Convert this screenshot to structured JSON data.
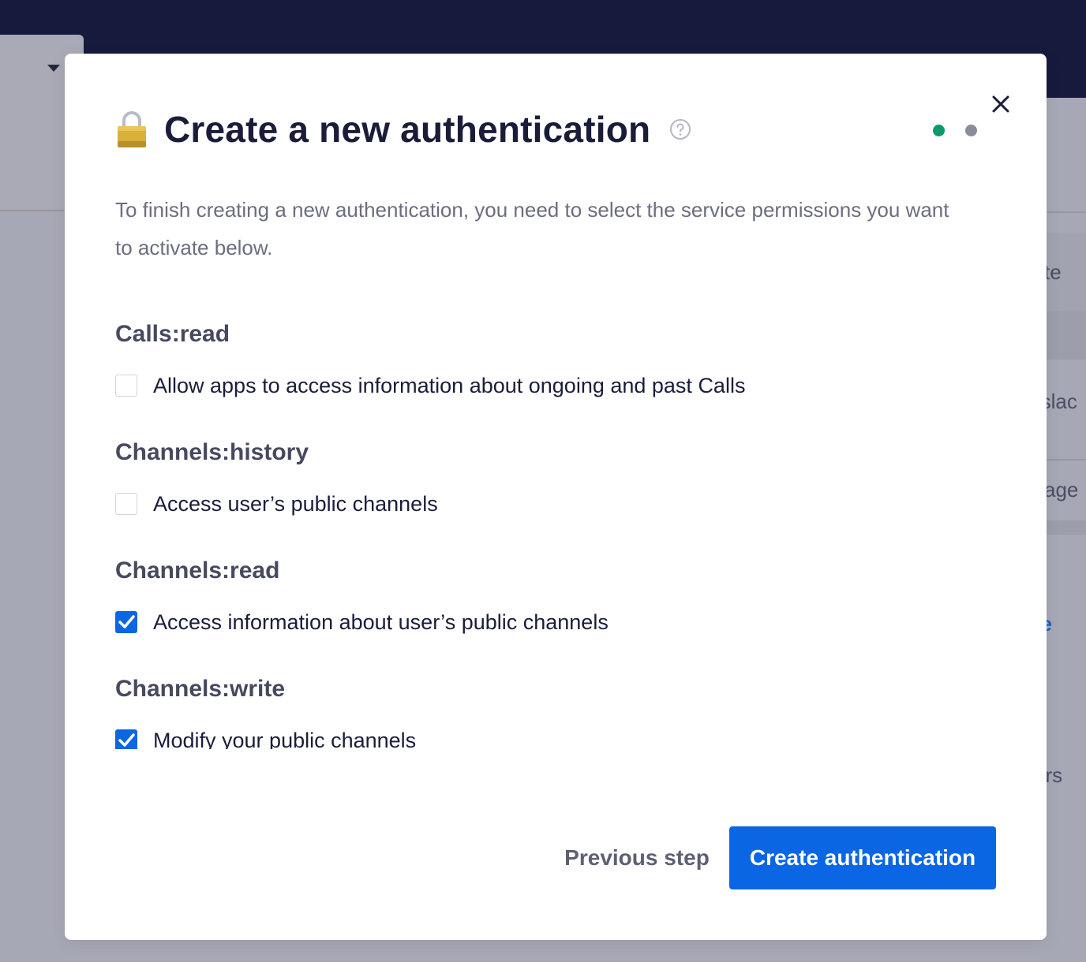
{
  "background": {
    "snippets": [
      "ste",
      "(slac",
      "sage",
      "te",
      "a",
      "ors"
    ]
  },
  "modal": {
    "title": "Create a new authentication",
    "intro": "To finish creating a new authentication, you need to select the service permissions you want to activate below.",
    "steps": [
      {
        "state": "current",
        "color": "#0a9a6b"
      },
      {
        "state": "upcoming",
        "color": "#8a8c99"
      }
    ],
    "permissions": [
      {
        "heading": "Calls:read",
        "label": "Allow apps to access information about ongoing and past Calls",
        "checked": false
      },
      {
        "heading": "Channels:history",
        "label": "Access user’s public channels",
        "checked": false
      },
      {
        "heading": "Channels:read",
        "label": "Access information about user’s public channels",
        "checked": true
      },
      {
        "heading": "Channels:write",
        "label": "Modify your public channels",
        "checked": true
      }
    ],
    "footer": {
      "previous_label": "Previous step",
      "create_label": "Create authentication"
    }
  },
  "colors": {
    "primary": "#0b66e4",
    "title": "#1a1d3a",
    "topbar": "#161a3c"
  }
}
